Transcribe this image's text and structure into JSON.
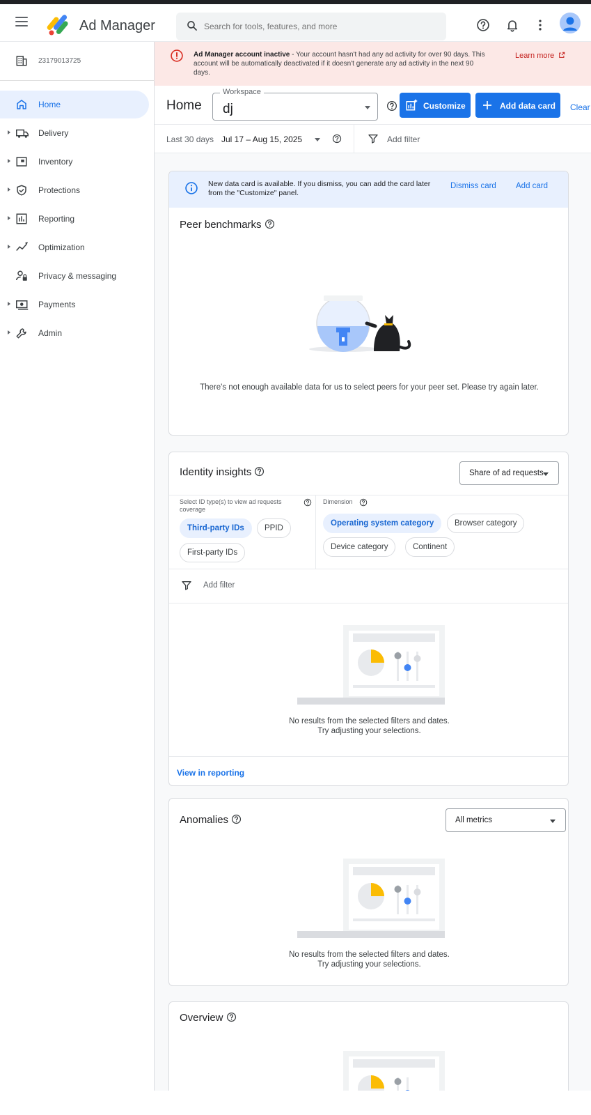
{
  "header": {
    "brand": "Ad Manager",
    "search_placeholder": "Search for tools, features, and more"
  },
  "sidebar": {
    "account_id": "23179013725",
    "items": [
      {
        "label": "Home",
        "icon": "home-icon",
        "active": true
      },
      {
        "label": "Delivery",
        "icon": "truck-icon"
      },
      {
        "label": "Inventory",
        "icon": "inventory-icon"
      },
      {
        "label": "Protections",
        "icon": "shield-icon"
      },
      {
        "label": "Reporting",
        "icon": "bar-chart-icon"
      },
      {
        "label": "Optimization",
        "icon": "trend-icon"
      },
      {
        "label": "Privacy & messaging",
        "icon": "person-lock-icon"
      },
      {
        "label": "Payments",
        "icon": "money-icon"
      },
      {
        "label": "Admin",
        "icon": "wrench-icon"
      }
    ]
  },
  "alert": {
    "title": "Ad Manager account inactive",
    "message": " - Your account hasn't had any ad activity for over 90 days. This account will be automatically deactivated if it doesn't generate any ad activity in the next 90 days.",
    "link": "Learn more"
  },
  "toolbar": {
    "page_title": "Home",
    "workspace_label": "Workspace",
    "workspace_value": "dj",
    "customize": "Customize",
    "add_data_card": "Add data card",
    "clear": "Clear"
  },
  "datebar": {
    "range_label": "Last 30 days",
    "range_value": "Jul 17 – Aug 15, 2025",
    "add_filter": "Add filter"
  },
  "banner": {
    "text": "New data card is available. If you dismiss, you can add the card later from the \"Customize\" panel.",
    "dismiss": "Dismiss card",
    "add": "Add card"
  },
  "peer": {
    "title": "Peer benchmarks",
    "empty": "There's not enough available data for us to select peers for your peer set. Please try again later."
  },
  "identity": {
    "title": "Identity insights",
    "select_value": "Share of ad requests",
    "id_label": "Select ID type(s) to view ad requests coverage",
    "dimension_label": "Dimension",
    "id_chips": [
      "Third-party IDs",
      "PPID",
      "First-party IDs"
    ],
    "dim_chips": [
      "Operating system category",
      "Browser category",
      "Device category",
      "Continent"
    ],
    "add_filter": "Add filter",
    "empty_line1": "No results from the selected filters and dates.",
    "empty_line2": "Try adjusting your selections.",
    "view_link": "View in reporting"
  },
  "anomalies": {
    "title": "Anomalies",
    "select_value": "All metrics",
    "empty_line1": "No results from the selected filters and dates.",
    "empty_line2": "Try adjusting your selections."
  },
  "overview": {
    "title": "Overview"
  },
  "colors": {
    "accent": "#1a73e8",
    "alert_bg": "#fce8e6",
    "alert_red": "#d93025",
    "info_bg": "#e8f0fe"
  }
}
